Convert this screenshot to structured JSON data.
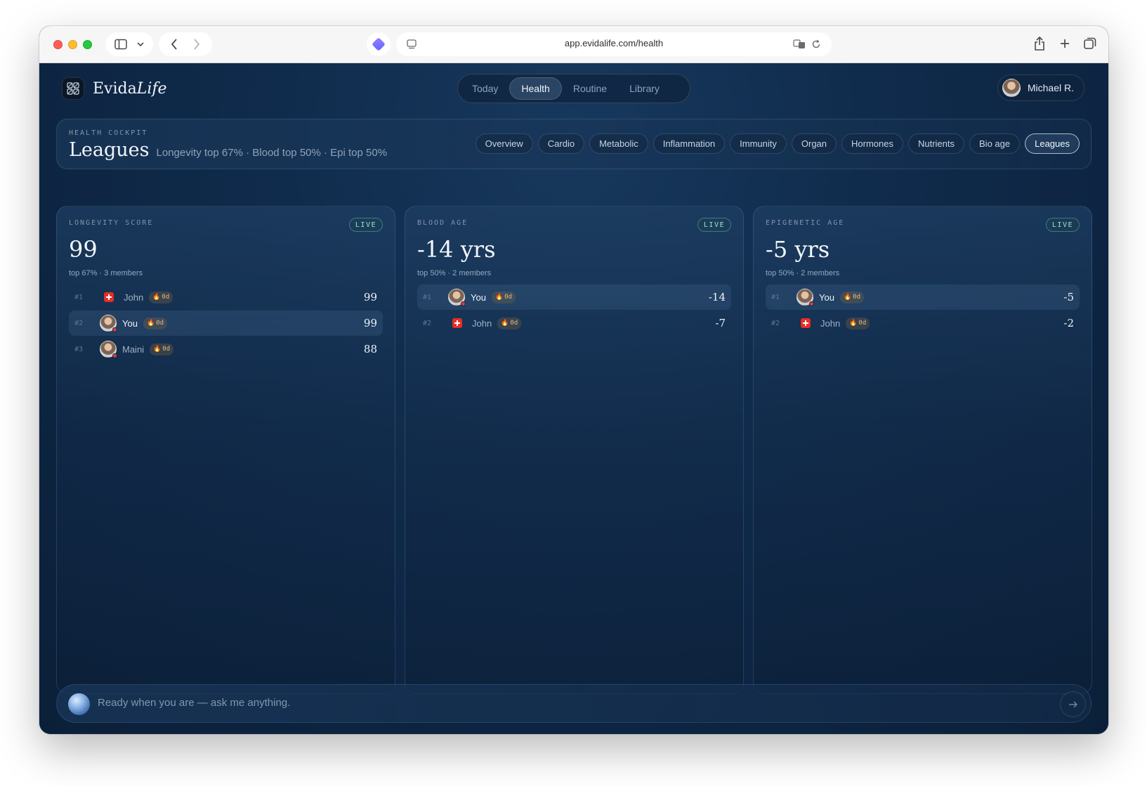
{
  "browser": {
    "url": "app.evidalife.com/health"
  },
  "brand": {
    "name_regular": "Evida",
    "name_italic": "Life"
  },
  "topnav": {
    "items": [
      {
        "label": "Today"
      },
      {
        "label": "Health",
        "active": true
      },
      {
        "label": "Routine"
      },
      {
        "label": "Library"
      }
    ]
  },
  "user": {
    "name": "Michael R."
  },
  "cockpit": {
    "eyebrow": "HEALTH COCKPIT",
    "title": "Leagues",
    "subtitle": "Longevity top 67% · Blood top 50% · Epi top 50%",
    "tabs": [
      {
        "label": "Overview"
      },
      {
        "label": "Cardio"
      },
      {
        "label": "Metabolic"
      },
      {
        "label": "Inflammation"
      },
      {
        "label": "Immunity"
      },
      {
        "label": "Organ"
      },
      {
        "label": "Hormones"
      },
      {
        "label": "Nutrients"
      },
      {
        "label": "Bio age"
      },
      {
        "label": "Leagues",
        "active": true
      }
    ]
  },
  "cards": [
    {
      "eyebrow": "LONGEVITY SCORE",
      "badge": "LIVE",
      "value": "99",
      "meta": "top 67% · 3 members",
      "rows": [
        {
          "rank": "#1",
          "name": "John",
          "streak": "0d",
          "score": "99",
          "marker": "flag",
          "me": false
        },
        {
          "rank": "#2",
          "name": "You",
          "streak": "0d",
          "score": "99",
          "marker": "avatar",
          "me": true
        },
        {
          "rank": "#3",
          "name": "Maini",
          "streak": "0d",
          "score": "88",
          "marker": "avatar",
          "me": false
        }
      ]
    },
    {
      "eyebrow": "BLOOD AGE",
      "badge": "LIVE",
      "value": "-14 yrs",
      "meta": "top 50% · 2 members",
      "rows": [
        {
          "rank": "#1",
          "name": "You",
          "streak": "0d",
          "score": "-14",
          "marker": "avatar",
          "me": true
        },
        {
          "rank": "#2",
          "name": "John",
          "streak": "0d",
          "score": "-7",
          "marker": "flag",
          "me": false
        }
      ]
    },
    {
      "eyebrow": "EPIGENETIC AGE",
      "badge": "LIVE",
      "value": "-5 yrs",
      "meta": "top 50% · 2 members",
      "rows": [
        {
          "rank": "#1",
          "name": "You",
          "streak": "0d",
          "score": "-5",
          "marker": "avatar",
          "me": true
        },
        {
          "rank": "#2",
          "name": "John",
          "streak": "0d",
          "score": "-2",
          "marker": "flag",
          "me": false
        }
      ]
    }
  ],
  "chat": {
    "placeholder": "Ready when you are — ask me anything."
  },
  "colors": {
    "accent_live": "#9fe0cf",
    "streak": "#e9b97c",
    "flag_red": "#e52d27",
    "background": "#0f2a4a"
  },
  "icons": {
    "send": "arrow-right-icon",
    "streak": "flame-icon"
  }
}
